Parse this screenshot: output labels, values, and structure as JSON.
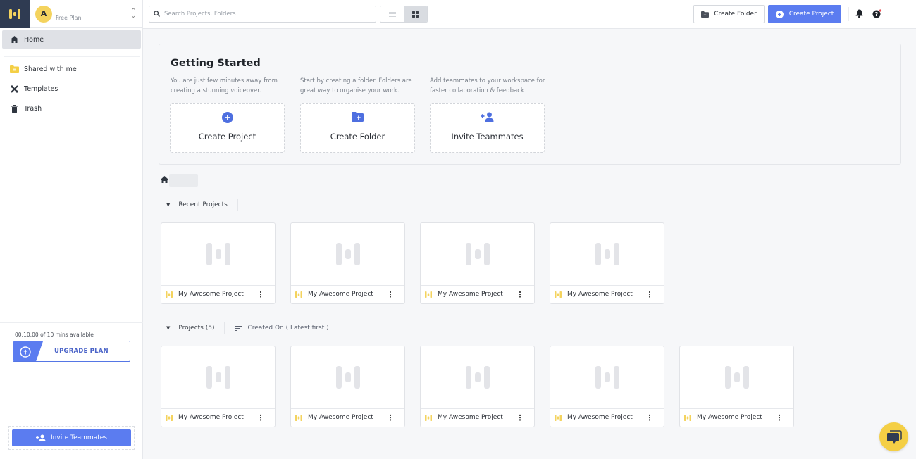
{
  "workspace": {
    "avatar_initial": "A",
    "plan": "Free Plan"
  },
  "sidebar": {
    "items": [
      {
        "label": "Home",
        "icon": "home-icon",
        "active": true
      },
      {
        "label": "Shared with me",
        "icon": "shared-folder-icon",
        "active": false
      },
      {
        "label": "Templates",
        "icon": "templates-icon",
        "active": false
      },
      {
        "label": "Trash",
        "icon": "trash-icon",
        "active": false
      }
    ],
    "usage": "00:10:00 of 10 mins available",
    "upgrade_label": "UPGRADE PLAN",
    "invite_label": "Invite Teammates"
  },
  "topbar": {
    "search_placeholder": "Search Projects, Folders",
    "search_value": "",
    "view_modes": [
      "list",
      "grid"
    ],
    "active_view": "grid",
    "create_folder_label": "Create Folder",
    "create_project_label": "Create Project",
    "colors": {
      "primary": "#5b7cf0",
      "brand_dark": "#2f3b52",
      "brand_yellow": "#f4d35e",
      "notification_dot": "#e5484d"
    }
  },
  "getting_started": {
    "title": "Getting Started",
    "cards": [
      {
        "desc": "You are just few minutes away from creating a stunning voiceover.",
        "label": "Create Project",
        "icon": "plus-circle-icon"
      },
      {
        "desc": "Start by creating a folder. Folders are great way to organise your work.",
        "label": "Create Folder",
        "icon": "folder-plus-icon"
      },
      {
        "desc": "Add teammates to your workspace for faster collaboration & feedback",
        "label": "Invite Teammates",
        "icon": "add-user-icon"
      }
    ]
  },
  "recent": {
    "title": "Recent Projects",
    "projects": [
      {
        "name": "My Awesome Project"
      },
      {
        "name": "My Awesome Project"
      },
      {
        "name": "My Awesome Project"
      },
      {
        "name": "My Awesome Project"
      }
    ]
  },
  "projects": {
    "title": "Projects (5)",
    "sort_label": "Created On ( Latest first )",
    "items": [
      {
        "name": "My Awesome Project"
      },
      {
        "name": "My Awesome Project"
      },
      {
        "name": "My Awesome Project"
      },
      {
        "name": "My Awesome Project"
      },
      {
        "name": "My Awesome Project"
      }
    ]
  }
}
